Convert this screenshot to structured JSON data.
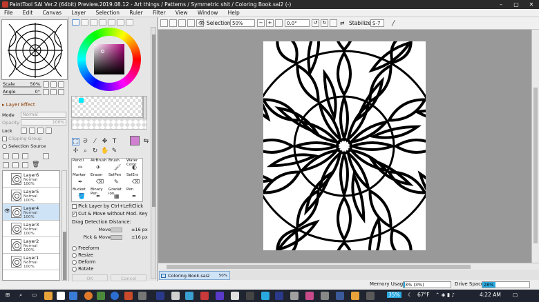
{
  "window": {
    "title": "PaintTool SAI Ver.2 (64bit) Preview.2019.08.12 - Art things / Patterns / Symmetric shit / Coloring Book.sai2 (-)"
  },
  "menu": [
    "File",
    "Edit",
    "Canvas",
    "Layer",
    "Selection",
    "Ruler",
    "Filter",
    "View",
    "Window",
    "Help"
  ],
  "navigator": {
    "scale_label": "Scale",
    "scale_value": "50%",
    "angle_label": "Angle",
    "angle_value": "0°"
  },
  "layer_effect": {
    "header": "Layer Effect",
    "mode_label": "Mode",
    "mode_value": "Normal",
    "opacity_label": "Opacity",
    "opacity_value": "100%",
    "lock_label": "Lock",
    "clipping_label": "Clipping Group",
    "selection_source_label": "Selection Source"
  },
  "layers": [
    {
      "name": "Layer6",
      "mode": "Normal",
      "opacity": "100%",
      "visible": false,
      "selected": false
    },
    {
      "name": "Layer5",
      "mode": "Normal",
      "opacity": "100%",
      "visible": false,
      "selected": false
    },
    {
      "name": "Layer4",
      "mode": "Normal",
      "opacity": "100%",
      "visible": true,
      "selected": true
    },
    {
      "name": "Layer3",
      "mode": "Normal",
      "opacity": "100%",
      "visible": false,
      "selected": false
    },
    {
      "name": "Layer2",
      "mode": "Normal",
      "opacity": "100%",
      "visible": false,
      "selected": false
    },
    {
      "name": "Layer1",
      "mode": "Normal",
      "opacity": "100%",
      "visible": false,
      "selected": false
    }
  ],
  "colors": {
    "current": "#d17fd1",
    "swatch": "#00eaff",
    "accent": "#2aa9e0"
  },
  "brushes": [
    {
      "line1": "Pencil",
      "line2": ""
    },
    {
      "line1": "AirBrush",
      "line2": ""
    },
    {
      "line1": "Brush",
      "line2": ""
    },
    {
      "line1": "Water",
      "line2": "Color"
    },
    {
      "line1": "Marker",
      "line2": ""
    },
    {
      "line1": "Eraser",
      "line2": ""
    },
    {
      "line1": "SelPen",
      "line2": ""
    },
    {
      "line1": "SelErs",
      "line2": ""
    },
    {
      "line1": "Bucket",
      "line2": ""
    },
    {
      "line1": "Binary",
      "line2": "Pen"
    },
    {
      "line1": "Gradat",
      "line2": "ion"
    },
    {
      "line1": "Pen",
      "line2": ""
    }
  ],
  "tool_options": {
    "pick_layer": "Pick Layer by Ctrl+LeftClick",
    "cut_move": "Cut & Move without Mod. Key",
    "drag_label": "Drag Detection Distance:",
    "move_label": "Move",
    "move_value": "±16 px",
    "pick_move_label": "Pick & Move",
    "pick_move_value": "±16 px",
    "radios": [
      "Freeform",
      "Resize",
      "Deform",
      "Rotate"
    ],
    "ok_label": "OK",
    "cancel_label": "Cancel"
  },
  "toolbar": {
    "selection_label": "Selection",
    "zoom_value": "50%",
    "rotation_value": "0.0°",
    "stabilizer_label": "Stabilizer",
    "stabilizer_value": "S-7"
  },
  "document": {
    "tab_name": "Coloring Book.sai2",
    "tab_zoom": "50%"
  },
  "status": {
    "memory_label": "Memory Usage",
    "memory_value": "3% (3%)",
    "memory_fraction": 0.03,
    "drive_label": "Drive Space",
    "drive_value": "28%",
    "drive_fraction": 0.28
  },
  "taskbar": {
    "battery": "35%",
    "temperature": "67°F",
    "time": "4:22 AM"
  }
}
